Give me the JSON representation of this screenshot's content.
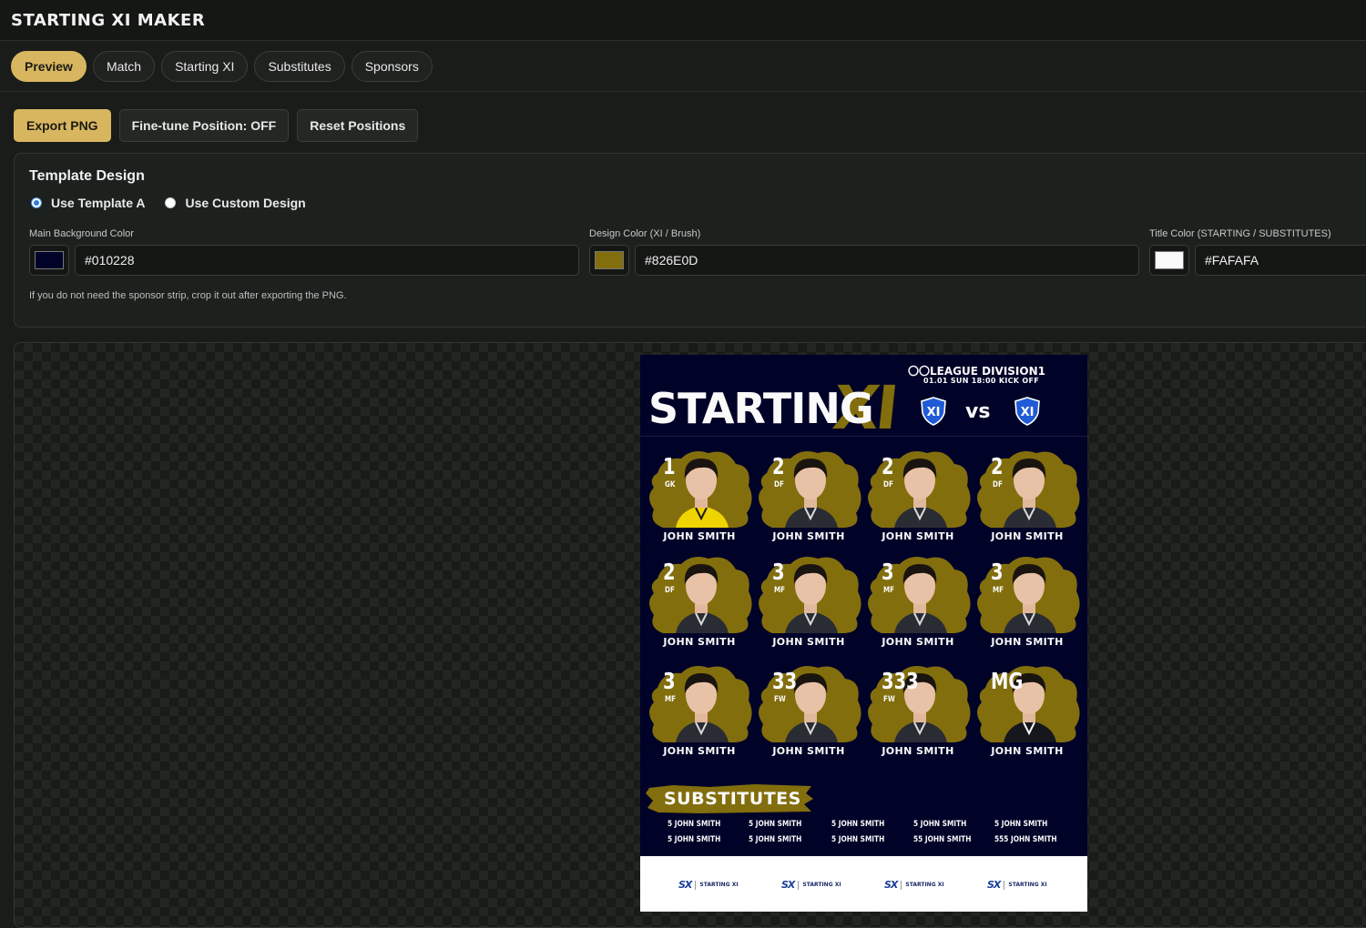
{
  "app": {
    "title": "STARTING XI MAKER"
  },
  "tabs": [
    {
      "label": "Preview",
      "active": true
    },
    {
      "label": "Match",
      "active": false
    },
    {
      "label": "Starting XI",
      "active": false
    },
    {
      "label": "Substitutes",
      "active": false
    },
    {
      "label": "Sponsors",
      "active": false
    }
  ],
  "toolbar": {
    "export_label": "Export PNG",
    "finetune_label": "Fine-tune Position: OFF",
    "reset_label": "Reset Positions"
  },
  "design": {
    "title": "Template Design",
    "option_template": "Use Template A",
    "option_custom": "Use Custom Design",
    "selected": "template",
    "main_bg_label": "Main Background Color",
    "main_bg_value": "#010228",
    "design_color_label": "Design Color (XI / Brush)",
    "design_color_value": "#826E0D",
    "title_color_label": "Title Color (STARTING / SUBSTITUTES)",
    "title_color_value": "#FAFAFA",
    "hint": "If you do not need the sponsor strip, crop it out after exporting the PNG."
  },
  "poster": {
    "league": "〇〇LEAGUE DIVISION1",
    "kickoff": "01.01 SUN 18:00 KICK OFF",
    "title_word": "STARTING",
    "title_xi": "XI",
    "vs": "vs",
    "crest_text": "XI",
    "players": [
      {
        "number": "1",
        "position": "GK",
        "name": "JOHN SMITH",
        "kit": "gk"
      },
      {
        "number": "2",
        "position": "DF",
        "name": "JOHN SMITH",
        "kit": "field"
      },
      {
        "number": "2",
        "position": "DF",
        "name": "JOHN SMITH",
        "kit": "field"
      },
      {
        "number": "2",
        "position": "DF",
        "name": "JOHN SMITH",
        "kit": "field"
      },
      {
        "number": "2",
        "position": "DF",
        "name": "JOHN SMITH",
        "kit": "field"
      },
      {
        "number": "3",
        "position": "MF",
        "name": "JOHN SMITH",
        "kit": "field"
      },
      {
        "number": "3",
        "position": "MF",
        "name": "JOHN SMITH",
        "kit": "field"
      },
      {
        "number": "3",
        "position": "MF",
        "name": "JOHN SMITH",
        "kit": "field"
      },
      {
        "number": "3",
        "position": "MF",
        "name": "JOHN SMITH",
        "kit": "field"
      },
      {
        "number": "33",
        "position": "FW",
        "name": "JOHN SMITH",
        "kit": "field"
      },
      {
        "number": "333",
        "position": "FW",
        "name": "JOHN SMITH",
        "kit": "field"
      },
      {
        "number": "MG",
        "position": "",
        "name": "JOHN SMITH",
        "kit": "suit"
      }
    ],
    "subs_title": "SUBSTITUTES",
    "subs": [
      "5 JOHN SMITH",
      "5 JOHN SMITH",
      "5 JOHN SMITH",
      "5 JOHN SMITH",
      "5 JOHN SMITH",
      "5 JOHN SMITH",
      "5 JOHN SMITH",
      "5 JOHN SMITH",
      "55 JOHN SMITH",
      "555 JOHN SMITH"
    ],
    "sponsors": [
      {
        "mark": "SX",
        "text": "STARTING XI"
      },
      {
        "mark": "SX",
        "text": "STARTING XI"
      },
      {
        "mark": "SX",
        "text": "STARTING XI"
      },
      {
        "mark": "SX",
        "text": "STARTING XI"
      }
    ]
  },
  "colors": {
    "accent": "#d8b660",
    "brush": "#826e0d",
    "poster_bg": "#010228",
    "title": "#fafafa"
  }
}
